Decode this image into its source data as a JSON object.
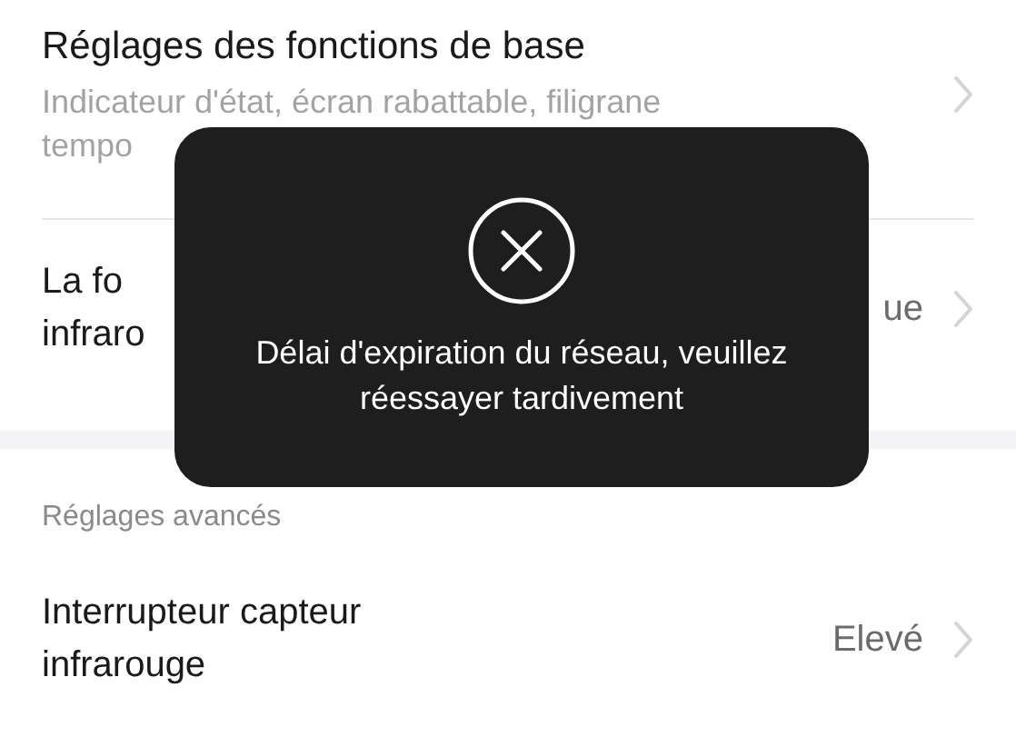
{
  "settings": [
    {
      "kind": "detail",
      "title_lines": [
        "Réglages des fonctions de base"
      ],
      "subtitle_lines": [
        "Indicateur d'état, écran rabattable, filigrane",
        "tempo"
      ]
    },
    {
      "kind": "value",
      "title_lines": [
        "La fo",
        "infraro"
      ],
      "value": "ue"
    }
  ],
  "advanced": {
    "header": "Réglages avancés",
    "items": [
      {
        "kind": "value",
        "title_lines": [
          "Interrupteur capteur",
          "infrarouge"
        ],
        "value": "Elevé"
      }
    ]
  },
  "toast": {
    "message": "Délai d'expiration du réseau, veuillez réessayer tardivement"
  }
}
